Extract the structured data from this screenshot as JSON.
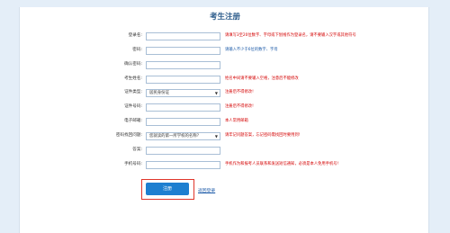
{
  "form": {
    "title": "考生注册",
    "fields": [
      {
        "label": "登录名:",
        "type": "input",
        "value": "",
        "hint": "请填写3至20位数字、字母或下划线作为登录名，请不要输入汉字或其他符号",
        "hint_color": "#d40000"
      },
      {
        "label": "密码:",
        "type": "input",
        "value": "",
        "hint": "请输入不少于6位的数字、字母",
        "hint_color": "#1c5aa8"
      },
      {
        "label": "确认密码:",
        "type": "input",
        "value": "",
        "hint": "",
        "hint_color": "#1c5aa8"
      },
      {
        "label": "考生姓名:",
        "type": "input",
        "value": "",
        "hint": "姓名中间请不要输入空格，注意后不能修改",
        "hint_color": "#d40000"
      },
      {
        "label": "证件类型:",
        "type": "select",
        "value": "居民身份证",
        "hint": "注册后不得修改!",
        "hint_color": "#d40000"
      },
      {
        "label": "证件号码:",
        "type": "input",
        "value": "",
        "hint": "注册后不得修改!",
        "hint_color": "#d40000"
      },
      {
        "label": "电子邮箱:",
        "type": "input",
        "value": "",
        "hint": "本人常用邮箱",
        "hint_color": "#d40000"
      },
      {
        "label": "密码找回问题:",
        "type": "select",
        "value": "您就读的第一所学校的名称？",
        "hint": "请牢记问题答案，忘记密码需找回时要用到!",
        "hint_color": "#d40000"
      },
      {
        "label": "答案:",
        "type": "input",
        "value": "",
        "hint": "",
        "hint_color": "#d40000"
      },
      {
        "label": "手机号码:",
        "type": "input",
        "value": "",
        "hint": "手机作为和报考人员联系和发送短信通知，必须是本人免用手机号!",
        "hint_color": "#d40000"
      }
    ],
    "submit_label": "注册",
    "back_label": "返回登录",
    "select_arrow": "▼"
  },
  "colors": {
    "background": "#e4eef8",
    "title": "#2a5a8a",
    "hint_red": "#d40000",
    "link_blue": "#1c5aa8",
    "button": "#1e7fd0",
    "highlight_frame": "#e0352a"
  }
}
